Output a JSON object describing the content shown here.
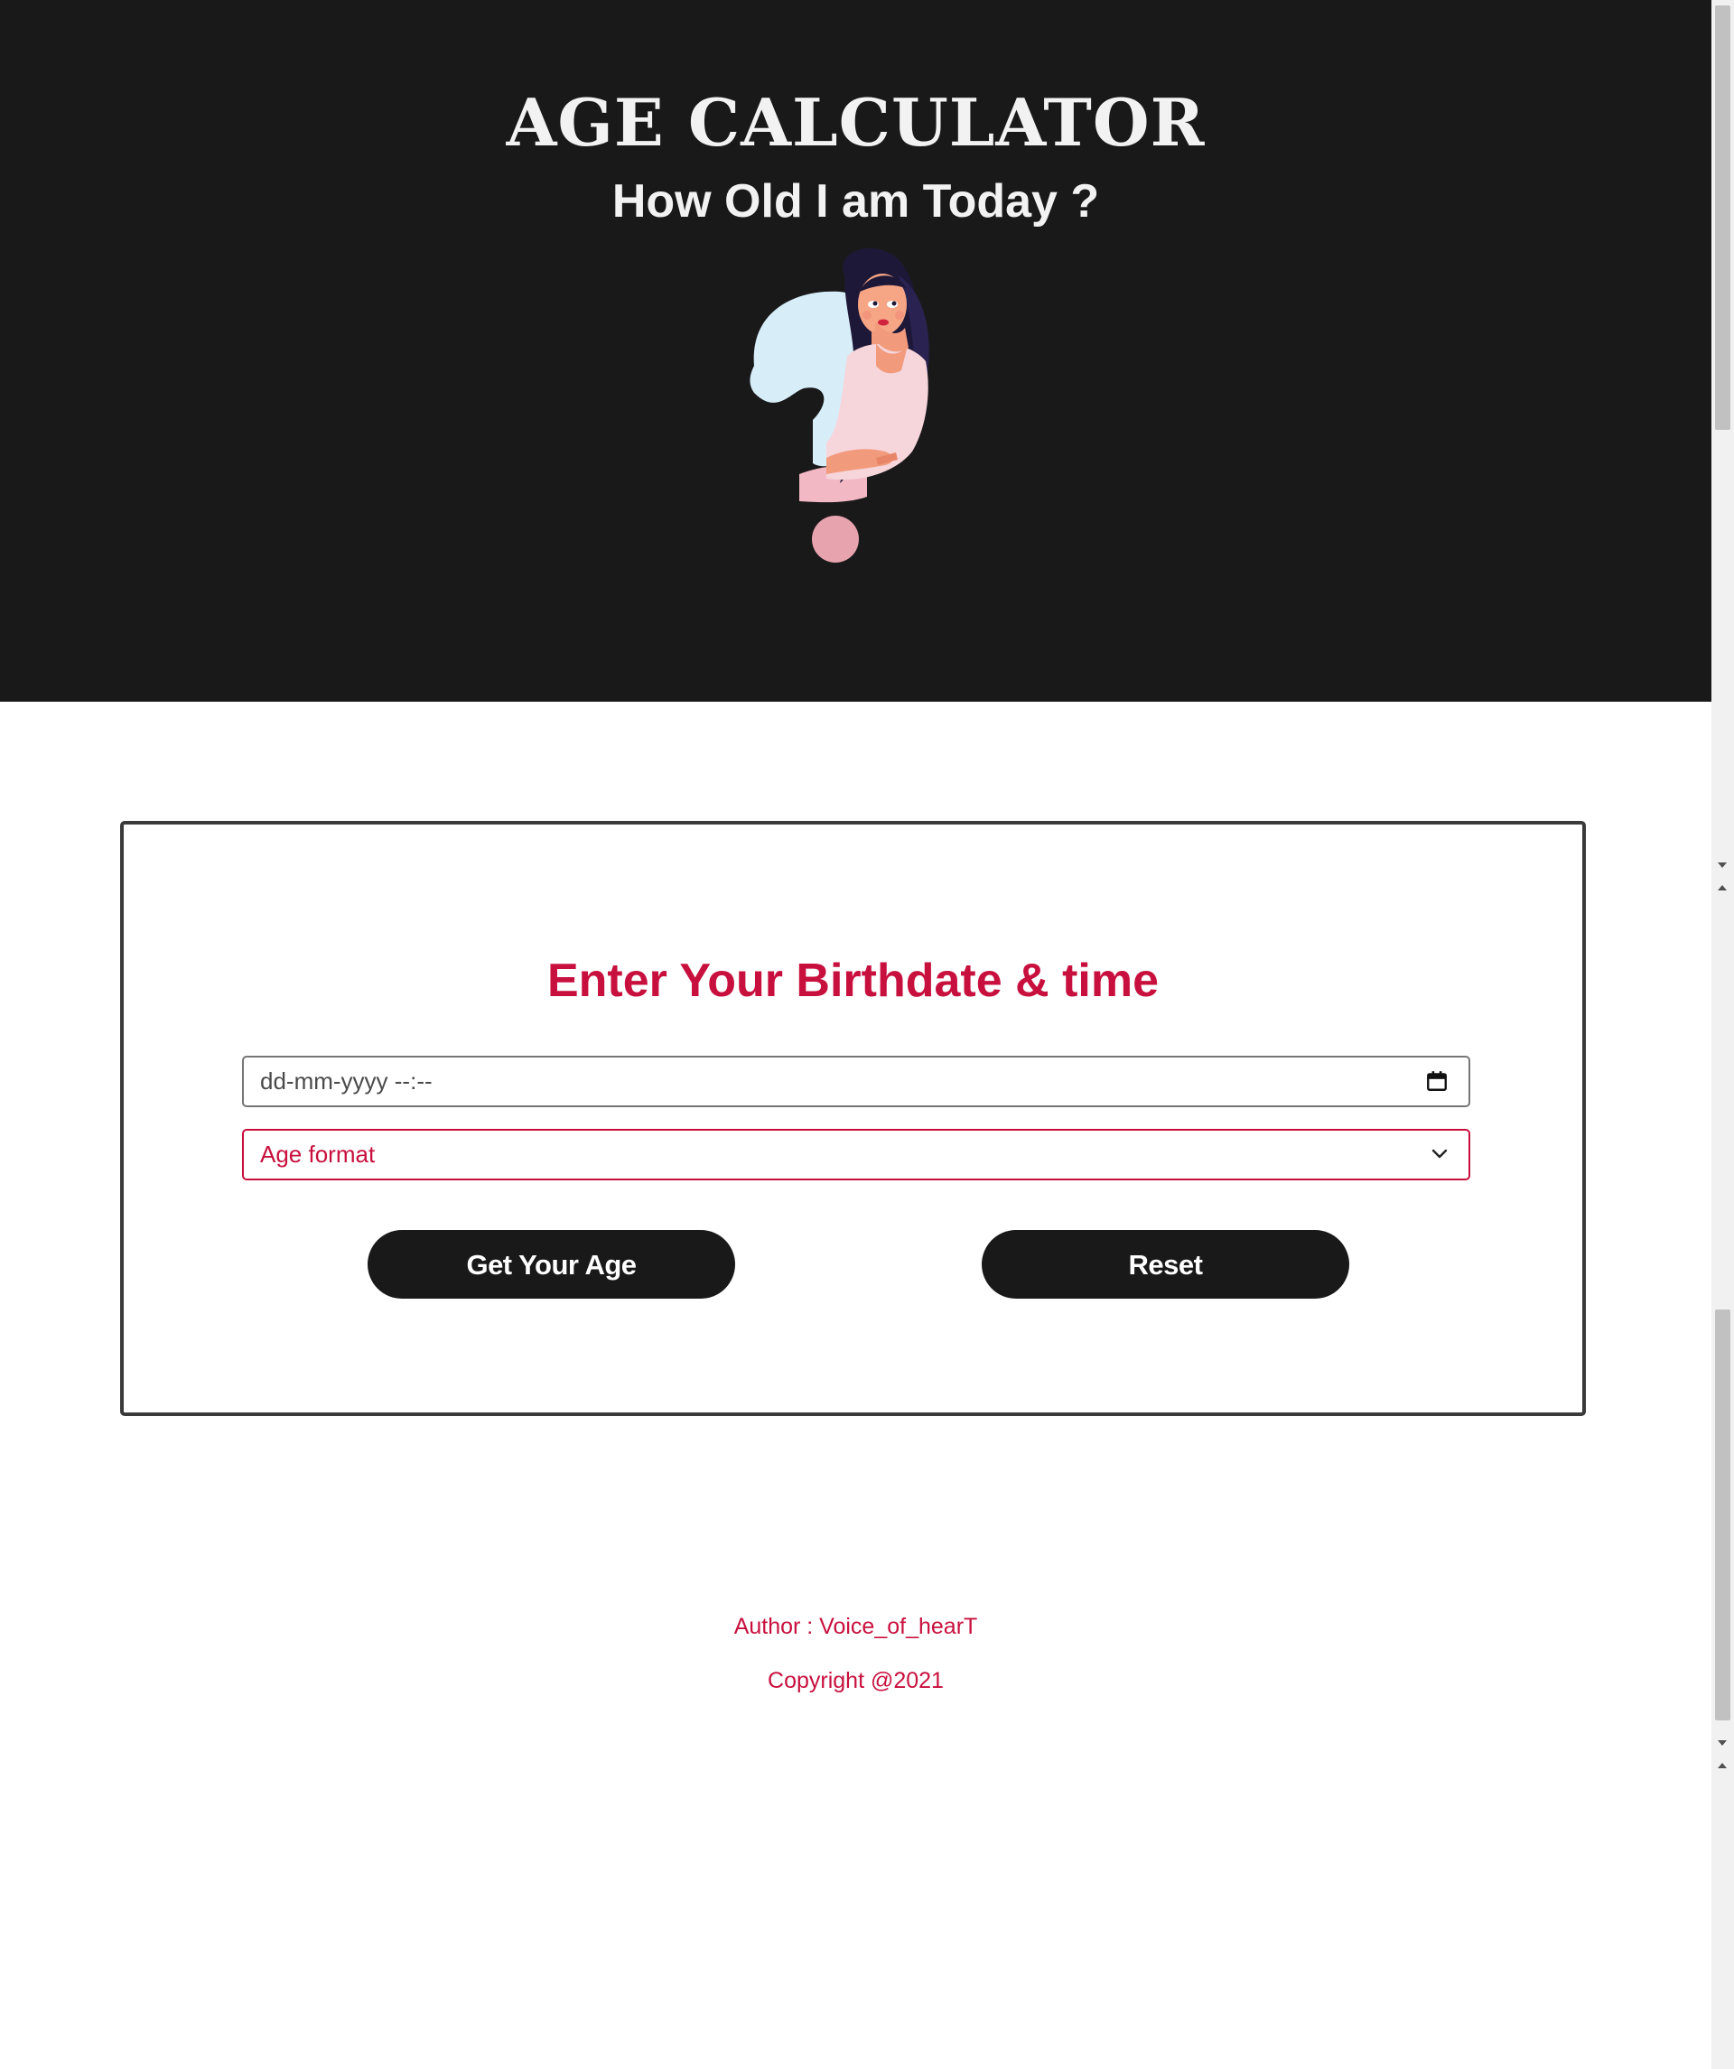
{
  "header": {
    "title": "AGE CALCULATOR",
    "subtitle": "How Old I am Today ?"
  },
  "form": {
    "heading": "Enter Your Birthdate & time",
    "datetime_placeholder": "dd-mm-yyyy --:--",
    "datetime_value": "",
    "format_select_value": "Age format",
    "buttons": {
      "get_age": "Get Your Age",
      "reset": "Reset"
    }
  },
  "footer": {
    "author": "Author : Voice_of_hearT",
    "copyright": "Copyright @2021"
  },
  "icons": {
    "calendar": "calendar-icon",
    "select_chevron": "chevron-down-icon",
    "illustration": "girl-question-mark-illustration"
  },
  "colors": {
    "header_background": "#1a191a",
    "accent": "#c8103e",
    "button_background": "#1a191a",
    "header_text": "#f2f2f2"
  }
}
